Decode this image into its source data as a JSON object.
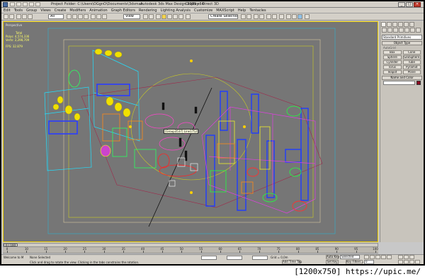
{
  "window": {
    "title_left": "Project Folder: C:\\Users\\OGgnO\\Documents\\3dsmax",
    "title_main": "Autodesk 3ds Max Design 2009 x64",
    "title_display": "Display : Direct 3D",
    "controls": [
      "_",
      "□",
      "✕"
    ]
  },
  "menu": [
    "Edit",
    "Tools",
    "Group",
    "Views",
    "Create",
    "Modifiers",
    "Animation",
    "Graph Editors",
    "Rendering",
    "Lighting Analysis",
    "Customize",
    "MAXScript",
    "Help",
    "Tentacles"
  ],
  "toolbar": {
    "selection_filter": "All",
    "ref_coord": "View",
    "named_selection": "Create Selection Set"
  },
  "viewport": {
    "label": "Perspective",
    "stats": {
      "header": "Total",
      "polys_label": "Polys:",
      "polys": "4,574,336",
      "verts_label": "Verts:",
      "verts": "2,298,709",
      "fps_label": "FPS:",
      "fps": "32.879"
    },
    "tooltip": "[Group3537] Line1752",
    "colors": {
      "background": "#767676",
      "active_border": "#f0d000",
      "safe_frame": "#cccc22"
    }
  },
  "command_panel": {
    "category": "Standard Primitives",
    "object_type_header": "Object Type",
    "autogrid": "AutoGrid",
    "buttons": [
      "Box",
      "Cone",
      "Sphere",
      "GeoSphere",
      "Cylinder",
      "Tube",
      "Torus",
      "Pyramid",
      "Teapot",
      "Plane"
    ],
    "name_color_header": "Name and Color",
    "swatch_color": "#8a0a20"
  },
  "timeline": {
    "slider": "0 / 100",
    "ticks": [
      "0",
      "10",
      "15",
      "20",
      "25",
      "30",
      "35",
      "40",
      "45",
      "50",
      "55",
      "60",
      "65",
      "70",
      "75",
      "80",
      "85",
      "90",
      "95",
      "100"
    ]
  },
  "status": {
    "selected": "None Selected",
    "prompt": "Click and drag to rotate the view. Clicking in the tabs constrains the rotation.",
    "grid": "Grid = 0,0m",
    "add_time_tag": "Add Time Tag",
    "auto_key": "Auto Key",
    "set_key": "Set Key",
    "key_filter": "Selected",
    "key_filters_btn": "Key Filters...",
    "frame": "0",
    "welcome": "Welcome to M"
  },
  "watermark": "[1200x750] https://upic.me/"
}
